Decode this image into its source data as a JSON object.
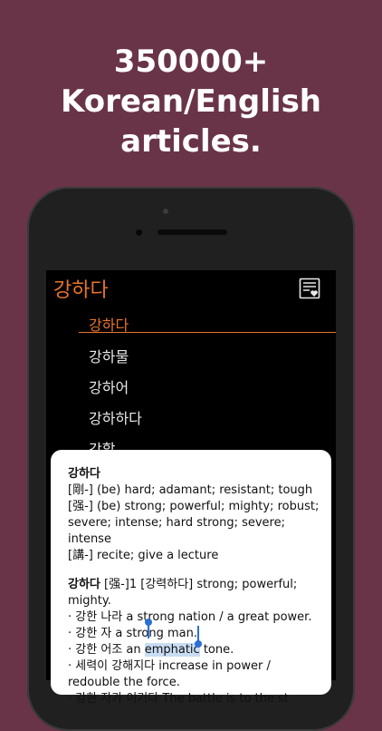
{
  "headline": {
    "line1": "350000+",
    "line2": "Korean/English",
    "line3": "articles."
  },
  "app": {
    "search_term": "강하다",
    "favorites_icon": "favorites-list-icon",
    "accent_color": "#e8742a",
    "list": [
      {
        "label": "강하다",
        "selected": true
      },
      {
        "label": "강하물",
        "selected": false
      },
      {
        "label": "강하어",
        "selected": false
      },
      {
        "label": "강하하다",
        "selected": false
      },
      {
        "label": "강할",
        "selected": false
      }
    ]
  },
  "popup": {
    "entry1": {
      "headword": "강하다",
      "lines": [
        "[剛-] (be) hard; adamant; resistant; tough",
        "[强-] (be) strong; powerful; mighty; robust;",
        "severe; intense; hard strong; severe; intense",
        "[講-] recite; give a lecture"
      ]
    },
    "entry2": {
      "headword": "강하다",
      "header_rest": " [强-]1 [강력하다] strong; powerful;",
      "header_line2": "mighty.",
      "examples": [
        "·  강한 나라 a strong nation / a great power.",
        "·  강한 자 a strong man."
      ],
      "example3_prefix": "·  강한 어조 an ",
      "example3_selected": "emphatic",
      "example3_suffix": " tone.",
      "example4": "·  세력이 강해지다 increase in power /",
      "example4_cont": "redouble the force.",
      "example5": "·  강한 자가 이기다 The battle is to the st"
    }
  }
}
